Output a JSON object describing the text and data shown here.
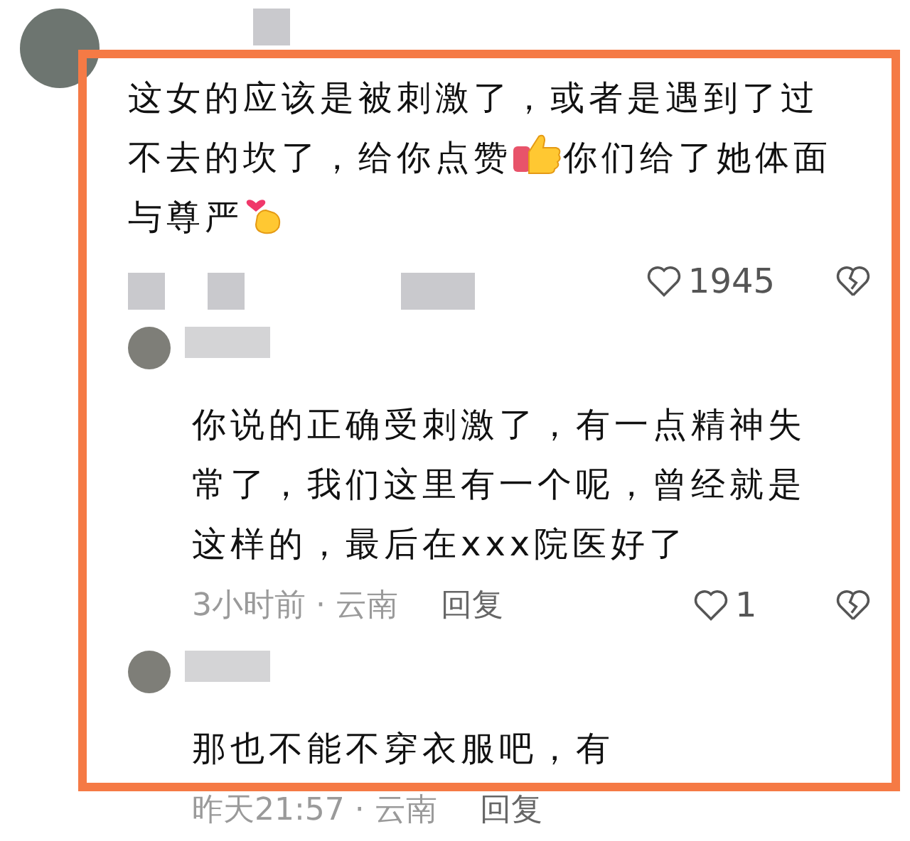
{
  "comments": [
    {
      "segments": [
        {
          "kind": "text",
          "text": "这女的应该是被刺激了，或者是遇到了过"
        },
        {
          "kind": "text",
          "text": "不去的坎了，给你点赞"
        },
        {
          "kind": "thumbs_up"
        },
        {
          "kind": "text",
          "text": "你们给了她体面"
        },
        {
          "kind": "text",
          "text": "与尊严"
        },
        {
          "kind": "finger_heart"
        }
      ],
      "likes": "1945",
      "replies": [
        {
          "segments": [
            {
              "kind": "text",
              "text": "你说的正确受刺激了，有一点精神失"
            },
            {
              "kind": "text",
              "text": "常了，我们这里有一个呢，曾经就是"
            },
            {
              "kind": "text",
              "text": "这样的，最后在xxx院医好了"
            }
          ],
          "meta": "3小时前 · 云南",
          "reply_label": "回复",
          "likes": "1"
        },
        {
          "segments": [
            {
              "kind": "text",
              "text": "那也不能不穿衣服吧，有"
            }
          ],
          "meta": "昨天21:57 · 云南",
          "reply_label": "回复"
        }
      ]
    }
  ]
}
